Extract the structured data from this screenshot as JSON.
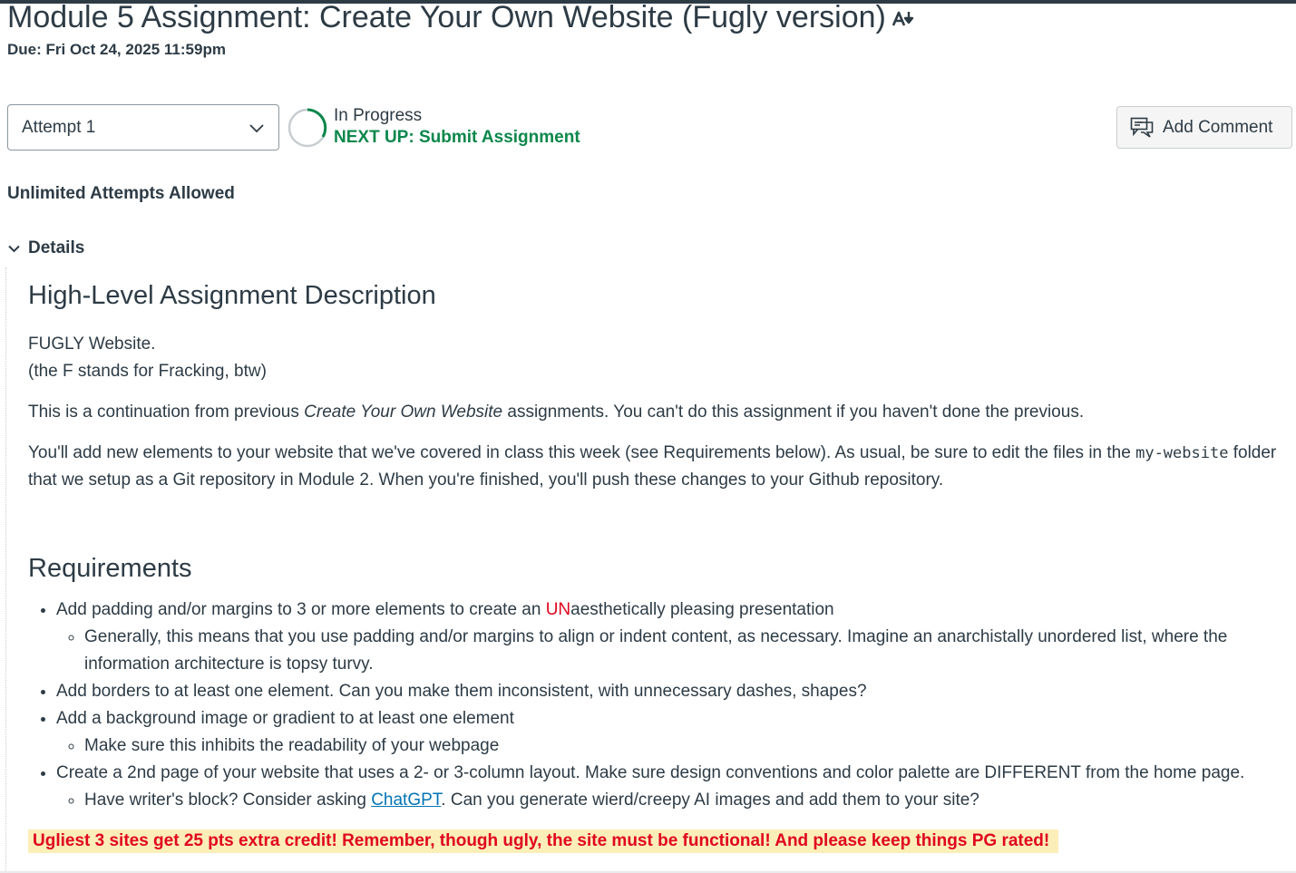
{
  "assignment": {
    "title": "Module 5 Assignment: Create Your Own Website (Fugly version)",
    "alert_icon": "text-direction-icon",
    "due": "Due: Fri Oct 24, 2025 11:59pm"
  },
  "attempt_select": {
    "value": "Attempt 1"
  },
  "status": {
    "label": "In Progress",
    "next_up": "NEXT UP: Submit Assignment",
    "colors": {
      "next_up": "#0b874b"
    }
  },
  "add_comment": {
    "label": "Add Comment",
    "icon": "comment-icon"
  },
  "attempts_allowed": "Unlimited Attempts Allowed",
  "details": {
    "toggle_label": "Details",
    "heading1": "High-Level Assignment Description",
    "p1_line1": "FUGLY Website.",
    "p1_line2": "(the F stands for Fracking, btw)",
    "p2_a": "This is a continuation from previous ",
    "p2_em": "Create Your Own Website",
    "p2_b": " assignments. You can't do this assignment if you haven't done the previous.",
    "p3_a": "You'll add new elements to your website that we've covered in class this week (see Requirements below). As usual, be sure to edit the files in the ",
    "p3_code": "my-website",
    "p3_b": " folder that we setup as a Git repository in Module 2. When you're finished, you'll push these changes to your Github repository.",
    "heading2": "Requirements",
    "req1_a": "Add padding and/or margins to 3 or more elements to create an ",
    "req1_un": "UN",
    "req1_b": "aesthetically pleasing presentation",
    "req1_sub": "Generally, this means that you use padding and/or margins to align or indent content, as necessary. Imagine an anarchistally unordered list, where the information architecture is topsy turvy.",
    "req2": "Add borders to at least one element. Can you make them inconsistent, with unnecessary dashes, shapes?",
    "req3": "Add a background image or gradient to at least one element",
    "req3_sub": "Make sure this inhibits the readability of your webpage",
    "req4": "Create a 2nd page of your website that uses a 2- or 3-column layout. Make sure design conventions and color palette are DIFFERENT from the home page.",
    "req4_sub_a": "Have writer's block? Consider asking ",
    "req4_sub_link": "ChatGPT",
    "req4_sub_b": ". Can you generate wierd/creepy AI images and add them to your site?",
    "extra_credit": "Ugliest 3 sites get 25 pts extra credit! Remember, though ugly, the site must be functional! And please keep things PG rated!",
    "colors": {
      "red": "#e0061f",
      "highlight": "#fbeeb8",
      "link": "#0374b5"
    }
  }
}
